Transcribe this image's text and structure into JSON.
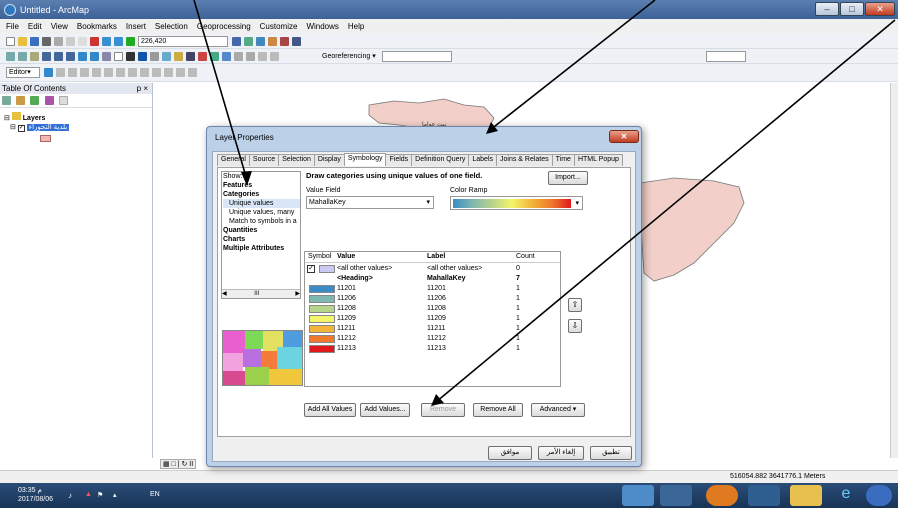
{
  "app": {
    "title": "Untitled - ArcMap"
  },
  "menu": [
    "File",
    "Edit",
    "View",
    "Bookmarks",
    "Insert",
    "Selection",
    "Geoprocessing",
    "Customize",
    "Windows",
    "Help"
  ],
  "toolbar": {
    "scale": "226,420",
    "georef_label": "Georeferencing ▾",
    "editor_label": "Editor▾"
  },
  "toc": {
    "title": "Table Of Contents",
    "layers_label": "Layers",
    "layer_name": "بلدية التجوراء",
    "pin": "p ×"
  },
  "dialog": {
    "title": "Layer Properties",
    "tabs": [
      "General",
      "Source",
      "Selection",
      "Display",
      "Symbology",
      "Fields",
      "Definition Query",
      "Labels",
      "Joins & Relates",
      "Time",
      "HTML Popup"
    ],
    "active_tab": "Symbology",
    "show_label": "Show:",
    "show_items": [
      {
        "text": "Features",
        "bold": true,
        "indent": false
      },
      {
        "text": "Categories",
        "bold": true,
        "indent": false
      },
      {
        "text": "Unique values",
        "bold": false,
        "indent": true,
        "selected": true
      },
      {
        "text": "Unique values, many",
        "bold": false,
        "indent": true
      },
      {
        "text": "Match to symbols in a",
        "bold": false,
        "indent": true
      },
      {
        "text": "Quantities",
        "bold": true,
        "indent": false
      },
      {
        "text": "Charts",
        "bold": true,
        "indent": false
      },
      {
        "text": "Multiple Attributes",
        "bold": true,
        "indent": false
      }
    ],
    "description": "Draw categories using unique values of one field.",
    "import_label": "Import...",
    "value_field_label": "Value Field",
    "value_field": "MahallaKey",
    "color_ramp_label": "Color Ramp",
    "columns": [
      "Symbol",
      "Value",
      "Label",
      "Count"
    ],
    "rows": [
      {
        "color": "#c9c9f2",
        "value": "<all other values>",
        "label": "<all other values>",
        "count": "0",
        "checkbox": true
      },
      {
        "color": "",
        "value": "<Heading>",
        "label": "MahallaKey",
        "count": "7",
        "bold": true
      },
      {
        "color": "#3b8bc6",
        "value": "11201",
        "label": "11201",
        "count": "1"
      },
      {
        "color": "#7fb8b0",
        "value": "11206",
        "label": "11206",
        "count": "1"
      },
      {
        "color": "#b8d38a",
        "value": "11208",
        "label": "11208",
        "count": "1"
      },
      {
        "color": "#f4f46a",
        "value": "11209",
        "label": "11209",
        "count": "1"
      },
      {
        "color": "#f3b43a",
        "value": "11211",
        "label": "11211",
        "count": "1"
      },
      {
        "color": "#ef7a2c",
        "value": "11212",
        "label": "11212",
        "count": "1"
      },
      {
        "color": "#e0191b",
        "value": "11213",
        "label": "11213",
        "count": "1"
      }
    ],
    "buttons": {
      "add_all": "Add All Values",
      "add": "Add Values...",
      "remove": "Remove",
      "remove_all": "Remove All",
      "advanced": "Advanced ▾"
    },
    "footer": {
      "apply": "تطبيق",
      "cancel": "إلغاء الأمر",
      "ok": "موافق"
    }
  },
  "map": {
    "region_label": "بيت عواما"
  },
  "status": {
    "coords": "516054.882  3641776.1 Meters"
  },
  "taskbar": {
    "time": "03:35",
    "ampm": "م",
    "date": "2017/08/06",
    "lang": "EN"
  }
}
